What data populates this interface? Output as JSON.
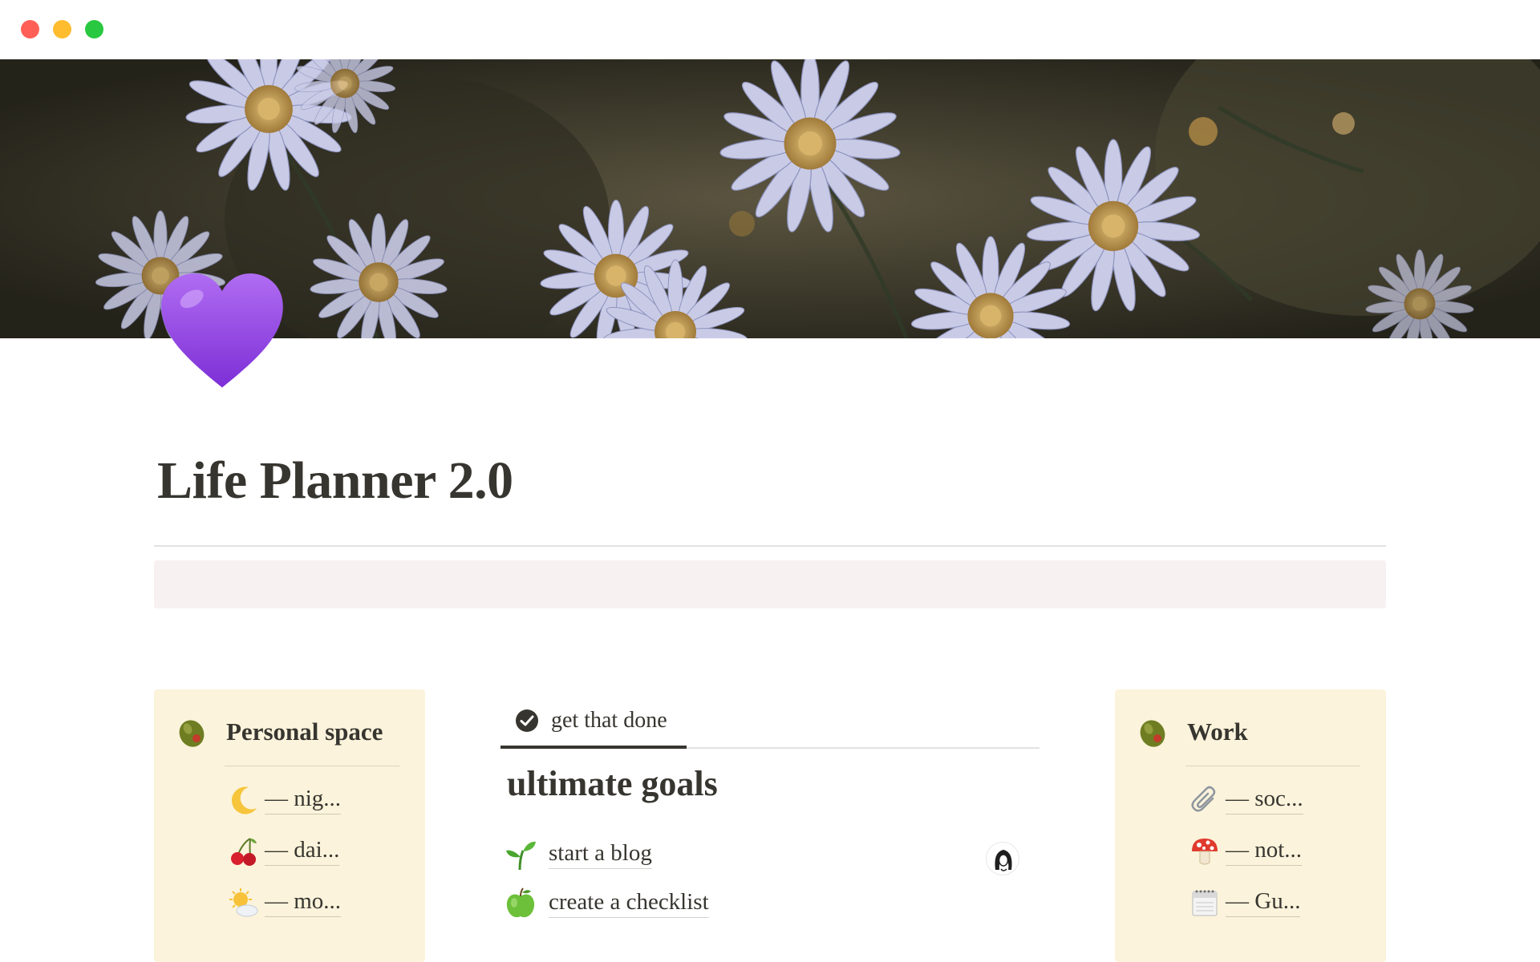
{
  "window": {
    "controls": [
      "close-button",
      "minimize-button",
      "maximize-button"
    ],
    "colors": {
      "close": "#ff5f57",
      "minimize": "#febc2e",
      "maximize": "#28c840"
    }
  },
  "cover": {
    "description_icon": "aster-flowers-photo"
  },
  "page": {
    "icon": "purple-heart-icon",
    "title": "Life Planner 2.0"
  },
  "personal_space": {
    "icon": "olive-icon",
    "title": "Personal space",
    "links": [
      {
        "icon": "crescent-moon-icon",
        "label": "— nig..."
      },
      {
        "icon": "cherries-icon",
        "label": "— dai..."
      },
      {
        "icon": "sun-behind-cloud-icon",
        "label": "— mo..."
      }
    ]
  },
  "tasks": {
    "tab_label": "get that done",
    "tab_icon": "check-circle-icon",
    "section_title": "ultimate goals",
    "goals": [
      {
        "icon": "seedling-icon",
        "label": "start a blog"
      },
      {
        "icon": "green-apple-icon",
        "label": "create a checklist"
      }
    ],
    "assignee_icon": "user-avatar-icon"
  },
  "work": {
    "icon": "olive-icon",
    "title": "Work",
    "links": [
      {
        "icon": "paperclip-icon",
        "label": "— soc..."
      },
      {
        "icon": "mushroom-icon",
        "label": "— not..."
      },
      {
        "icon": "calendar-icon",
        "label": "— Gu..."
      }
    ]
  },
  "colors": {
    "text": "#37352f",
    "card_bg": "#fbf3db",
    "callout_bg": "#f8f1f2",
    "heart": "#9b4be6"
  }
}
